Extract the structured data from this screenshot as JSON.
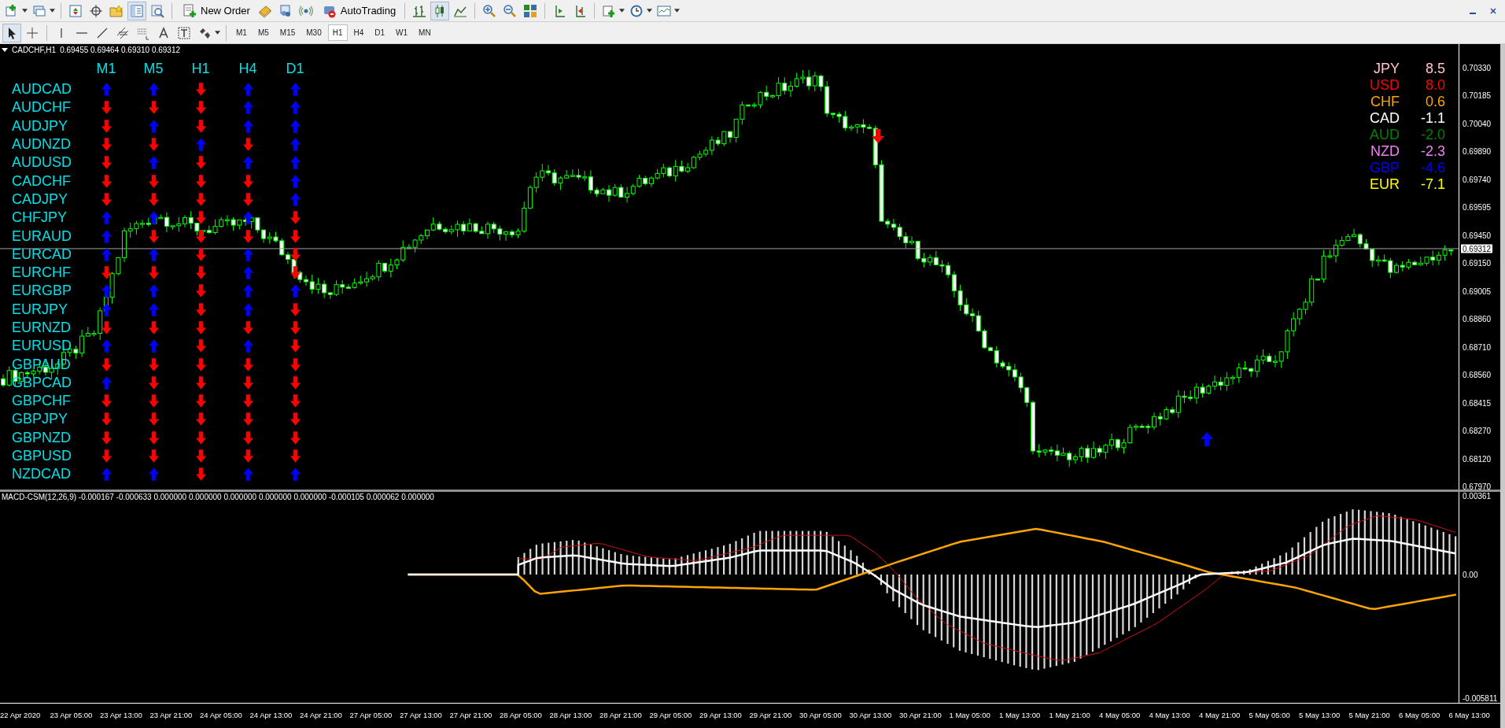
{
  "toolbar": {
    "new_order": "New Order",
    "autotrading": "AutoTrading"
  },
  "timeframes": [
    {
      "label": "M1",
      "selected": false
    },
    {
      "label": "M5",
      "selected": false
    },
    {
      "label": "M15",
      "selected": false
    },
    {
      "label": "M30",
      "selected": false
    },
    {
      "label": "H1",
      "selected": true
    },
    {
      "label": "H4",
      "selected": false
    },
    {
      "label": "D1",
      "selected": false
    },
    {
      "label": "W1",
      "selected": false
    },
    {
      "label": "MN",
      "selected": false
    }
  ],
  "chart": {
    "symbol": "CADCHF,H1",
    "ohlc": "0.69455 0.69464 0.69310 0.69312",
    "timeframe_headers": [
      "M1",
      "M5",
      "H1",
      "H4",
      "D1"
    ],
    "pairs": [
      {
        "name": "AUDCAD",
        "signals": [
          {
            "up": true
          },
          {
            "up": true
          },
          {
            "up": false
          },
          {
            "up": true
          },
          {
            "up": true
          }
        ]
      },
      {
        "name": "AUDCHF",
        "signals": [
          {
            "up": false
          },
          {
            "up": false
          },
          {
            "up": false
          },
          {
            "up": true
          },
          {
            "up": true
          }
        ]
      },
      {
        "name": "AUDJPY",
        "signals": [
          {
            "up": false
          },
          {
            "up": true
          },
          {
            "up": false
          },
          {
            "up": true
          },
          {
            "up": true
          }
        ]
      },
      {
        "name": "AUDNZD",
        "signals": [
          {
            "up": false
          },
          {
            "up": false
          },
          {
            "up": true
          },
          {
            "up": false
          },
          {
            "up": true
          }
        ]
      },
      {
        "name": "AUDUSD",
        "signals": [
          {
            "up": false
          },
          {
            "up": true
          },
          {
            "up": false
          },
          {
            "up": true
          },
          {
            "up": true
          }
        ]
      },
      {
        "name": "CADCHF",
        "signals": [
          {
            "up": false
          },
          {
            "up": false
          },
          {
            "up": false
          },
          {
            "up": false
          },
          {
            "up": true
          }
        ]
      },
      {
        "name": "CADJPY",
        "signals": [
          {
            "up": false
          },
          {
            "up": false
          },
          {
            "up": false
          },
          {
            "up": false
          },
          {
            "up": true
          }
        ]
      },
      {
        "name": "CHFJPY",
        "signals": [
          {
            "up": true
          },
          {
            "up": true
          },
          {
            "up": false
          },
          {
            "up": true
          },
          {
            "up": false
          }
        ]
      },
      {
        "name": "EURAUD",
        "signals": [
          {
            "up": true
          },
          {
            "up": false
          },
          {
            "up": false
          },
          {
            "up": false
          },
          {
            "up": false
          }
        ]
      },
      {
        "name": "EURCAD",
        "signals": [
          {
            "up": true
          },
          {
            "up": true
          },
          {
            "up": false
          },
          {
            "up": true
          },
          {
            "up": false
          }
        ]
      },
      {
        "name": "EURCHF",
        "signals": [
          {
            "up": false
          },
          {
            "up": false
          },
          {
            "up": false
          },
          {
            "up": true
          },
          {
            "up": false
          }
        ]
      },
      {
        "name": "EURGBP",
        "signals": [
          {
            "up": true
          },
          {
            "up": true
          },
          {
            "up": false
          },
          {
            "up": true
          },
          {
            "up": true
          }
        ]
      },
      {
        "name": "EURJPY",
        "signals": [
          {
            "up": true
          },
          {
            "up": true
          },
          {
            "up": false
          },
          {
            "up": true
          },
          {
            "up": false
          }
        ]
      },
      {
        "name": "EURNZD",
        "signals": [
          {
            "up": false
          },
          {
            "up": false
          },
          {
            "up": false
          },
          {
            "up": false
          },
          {
            "up": false
          }
        ]
      },
      {
        "name": "EURUSD",
        "signals": [
          {
            "up": true
          },
          {
            "up": true
          },
          {
            "up": false
          },
          {
            "up": true
          },
          {
            "up": false
          }
        ]
      },
      {
        "name": "GBPAUD",
        "signals": [
          {
            "up": false
          },
          {
            "up": false
          },
          {
            "up": false
          },
          {
            "up": false
          },
          {
            "up": false
          }
        ]
      },
      {
        "name": "GBPCAD",
        "signals": [
          {
            "up": true
          },
          {
            "up": false
          },
          {
            "up": false
          },
          {
            "up": false
          },
          {
            "up": false
          }
        ]
      },
      {
        "name": "GBPCHF",
        "signals": [
          {
            "up": false
          },
          {
            "up": false
          },
          {
            "up": false
          },
          {
            "up": false
          },
          {
            "up": false
          }
        ]
      },
      {
        "name": "GBPJPY",
        "signals": [
          {
            "up": false
          },
          {
            "up": false
          },
          {
            "up": false
          },
          {
            "up": false
          },
          {
            "up": false
          }
        ]
      },
      {
        "name": "GBPNZD",
        "signals": [
          {
            "up": false
          },
          {
            "up": false
          },
          {
            "up": false
          },
          {
            "up": false
          },
          {
            "up": false
          }
        ]
      },
      {
        "name": "GBPUSD",
        "signals": [
          {
            "up": false
          },
          {
            "up": false
          },
          {
            "up": false
          },
          {
            "up": false
          },
          {
            "up": false
          }
        ]
      },
      {
        "name": "NZDCAD",
        "signals": [
          {
            "up": true
          },
          {
            "up": true
          },
          {
            "up": false
          },
          {
            "up": true
          },
          {
            "up": true
          }
        ]
      }
    ],
    "strength": [
      {
        "currency": "JPY",
        "value": "8.5",
        "color": "#ffc0cb"
      },
      {
        "currency": "USD",
        "value": "8.0",
        "color": "#ff0000"
      },
      {
        "currency": "CHF",
        "value": "0.6",
        "color": "#ffa500"
      },
      {
        "currency": "CAD",
        "value": "-1.1",
        "color": "#ffffff"
      },
      {
        "currency": "AUD",
        "value": "-2.0",
        "color": "#008000"
      },
      {
        "currency": "NZD",
        "value": "-2.3",
        "color": "#ee82ee"
      },
      {
        "currency": "GBP",
        "value": "-4.6",
        "color": "#0000ff"
      },
      {
        "currency": "EUR",
        "value": "-7.1",
        "color": "#ffff00"
      }
    ],
    "price_axis": [
      "0.70330",
      "0.70185",
      "0.70040",
      "0.69890",
      "0.69740",
      "0.69595",
      "0.69450",
      "0.69150",
      "0.69005",
      "0.68860",
      "0.68710",
      "0.68560",
      "0.68415",
      "0.68270",
      "0.68120",
      "0.67970"
    ],
    "current_price": "0.69312"
  },
  "indicator": {
    "title": "MACD-CSM(12,26,9) -0.000167 -0.000633 0.000000 0.000000 0.000000 0.000000 0.000000 -0.000105 0.000062 0.000000",
    "axis": [
      "0.00361",
      "0.00",
      "-0.005811"
    ]
  },
  "time_axis": [
    "22 Apr 2020",
    "23 Apr 05:00",
    "23 Apr 13:00",
    "23 Apr 21:00",
    "24 Apr 05:00",
    "24 Apr 13:00",
    "24 Apr 21:00",
    "27 Apr 05:00",
    "27 Apr 13:00",
    "27 Apr 21:00",
    "28 Apr 05:00",
    "28 Apr 13:00",
    "28 Apr 21:00",
    "29 Apr 05:00",
    "29 Apr 13:00",
    "29 Apr 21:00",
    "30 Apr 05:00",
    "30 Apr 13:00",
    "30 Apr 21:00",
    "1 May 05:00",
    "1 May 13:00",
    "1 May 21:00",
    "4 May 05:00",
    "4 May 13:00",
    "4 May 21:00",
    "5 May 05:00",
    "5 May 13:00",
    "5 May 21:00",
    "6 May 05:00",
    "6 May 13:00"
  ]
}
